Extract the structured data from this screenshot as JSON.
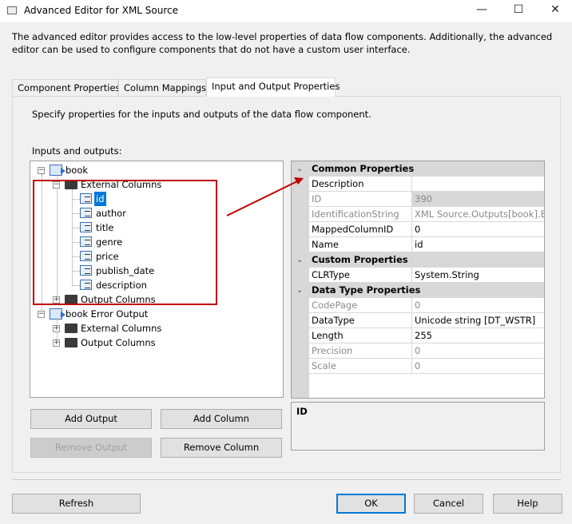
{
  "window": {
    "title": "Advanced Editor for XML Source",
    "minimize": "—",
    "maximize": "☐",
    "close": "✕"
  },
  "description": "The advanced editor provides access to the low-level properties of data flow components. Additionally, the advanced editor can be used to configure components that do not have a custom user interface.",
  "tabs": [
    {
      "label": "Component Properties"
    },
    {
      "label": "Column Mappings"
    },
    {
      "label": "Input and Output Properties"
    }
  ],
  "panel": {
    "instruction": "Specify properties for the inputs and outputs of the data flow component.",
    "tree_label": "Inputs and outputs:"
  },
  "tree": {
    "book": "book",
    "external_columns": "External Columns",
    "columns": [
      "id",
      "author",
      "title",
      "genre",
      "price",
      "publish_date",
      "description"
    ],
    "output_columns": "Output Columns",
    "error_output": "book Error Output",
    "err_external": "External Columns",
    "err_output": "Output Columns",
    "selected": "id"
  },
  "properties": {
    "categories": [
      {
        "name": "Common Properties",
        "rows": [
          {
            "name": "Description",
            "value": "",
            "disabled": false
          },
          {
            "name": "ID",
            "value": "390",
            "disabled": true
          },
          {
            "name": "IdentificationString",
            "value": "XML Source.Outputs[book].Ext",
            "disabled": true
          },
          {
            "name": "MappedColumnID",
            "value": "0",
            "disabled": false
          },
          {
            "name": "Name",
            "value": "id",
            "disabled": false
          }
        ]
      },
      {
        "name": "Custom Properties",
        "rows": [
          {
            "name": "CLRType",
            "value": "System.String",
            "disabled": false
          }
        ]
      },
      {
        "name": "Data Type Properties",
        "rows": [
          {
            "name": "CodePage",
            "value": "0",
            "disabled": true
          },
          {
            "name": "DataType",
            "value": "Unicode string [DT_WSTR]",
            "disabled": false
          },
          {
            "name": "Length",
            "value": "255",
            "disabled": false
          },
          {
            "name": "Precision",
            "value": "0",
            "disabled": true
          },
          {
            "name": "Scale",
            "value": "0",
            "disabled": true
          }
        ]
      }
    ],
    "help_title": "ID"
  },
  "buttons": {
    "add_output": "Add Output",
    "add_column": "Add Column",
    "remove_output": "Remove Output",
    "remove_column": "Remove Column",
    "refresh": "Refresh",
    "ok": "OK",
    "cancel": "Cancel",
    "help": "Help"
  },
  "colors": {
    "annotation": "#c00000",
    "selection": "#0078d7"
  }
}
